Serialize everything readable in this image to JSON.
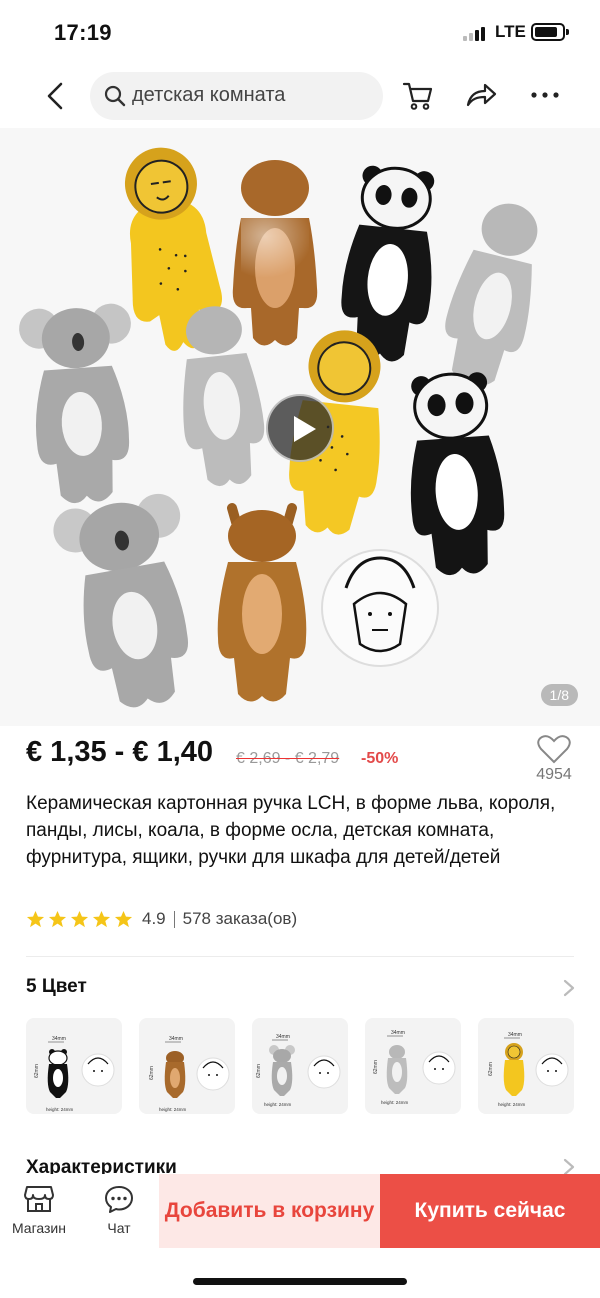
{
  "status": {
    "time": "17:19",
    "network": "LTE"
  },
  "search": {
    "query": "детская комната"
  },
  "gallery": {
    "counter": "1/8"
  },
  "price": {
    "current": "€ 1,35 - € 1,40",
    "original": "€ 2,69 - € 2,79",
    "discount": "-50%"
  },
  "wishlist": {
    "count": "4954"
  },
  "title": "Керамическая картонная ручка LCH, в форме льва, короля, панды, лисы, коала, в форме осла, детская комната, фурнитура, ящики, ручки для шкафа для детей/детей",
  "rating": {
    "value": "4.9",
    "stars": 5,
    "orders": "578 заказа(ов)"
  },
  "colors": {
    "title": "5 Цвет",
    "swatches": [
      {
        "name": "panda",
        "width_label": "34mm",
        "height_label": "62mm",
        "depth_label": "height: 24mm"
      },
      {
        "name": "fox",
        "width_label": "34mm",
        "height_label": "62mm",
        "depth_label": "height: 24mm"
      },
      {
        "name": "koala",
        "width_label": "34mm",
        "height_label": "62mm",
        "depth_label": "height: 24mm"
      },
      {
        "name": "donkey",
        "width_label": "34mm",
        "height_label": "62mm",
        "depth_label": "height: 24mm"
      },
      {
        "name": "lion",
        "width_label": "34mm",
        "height_label": "62mm",
        "depth_label": "height: 24mm"
      }
    ]
  },
  "specs": {
    "title": "Характеристики"
  },
  "bottom": {
    "store_label": "Магазин",
    "chat_label": "Чат",
    "add_to_cart": "Добавить в корзину",
    "buy_now": "Купить сейчас"
  },
  "colors_palette": {
    "accent": "#ec4f46",
    "accent_light": "#fde8e6",
    "star": "#f5c518",
    "discount": "#e34a4a"
  }
}
